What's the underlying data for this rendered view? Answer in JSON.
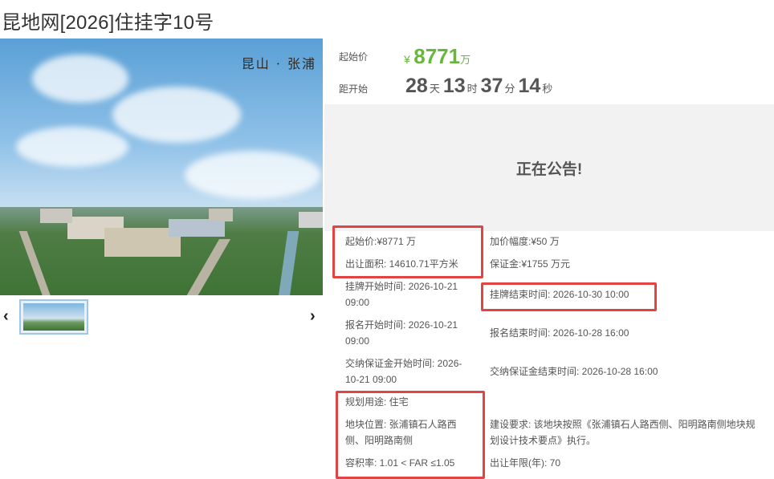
{
  "page_title": "昆地网[2026]住挂字10号",
  "photo": {
    "caption": "昆山 · 张浦"
  },
  "carousel": {
    "prev_label": "‹",
    "next_label": "›"
  },
  "price": {
    "label": "起始价",
    "currency": "¥",
    "value": "8771",
    "unit": "万"
  },
  "countdown": {
    "label": "距开始",
    "days": "28",
    "days_unit": "天",
    "hours": "13",
    "hours_unit": "时",
    "minutes": "37",
    "minutes_unit": "分",
    "seconds": "14",
    "seconds_unit": "秒"
  },
  "notice": "正在公告!",
  "details": {
    "start_price": "起始价:¥8771 万",
    "area": "出让面积: 14610.71平方米",
    "bid_increment": "加价幅度:¥50 万",
    "deposit": "保证金:¥1755 万元",
    "listing_start_1": "挂牌开始时间: 2026-10-21",
    "listing_start_2": "09:00",
    "listing_end": "挂牌结束时间: 2026-10-30 10:00",
    "signup_start_1": "报名开始时间: 2026-10-21",
    "signup_start_2": "09:00",
    "signup_end": "报名结束时间: 2026-10-28 16:00",
    "deposit_start_1": "交纳保证金开始时间: 2026-",
    "deposit_start_2": "10-21 09:00",
    "deposit_end": "交纳保证金结束时间: 2026-10-28 16:00",
    "usage": "规划用途: 住宅",
    "location_1": "地块位置: 张浦镇石人路西",
    "location_2": "侧、阳明路南侧",
    "far": "容积率: 1.01 < FAR ≤1.05",
    "requirement_1": "建设要求: 该地块按照《张浦镇石人路西侧、阳明路南侧地块规",
    "requirement_2": "划设计技术要点》执行。",
    "term": "出让年限(年): 70"
  },
  "colors": {
    "price_green": "#66b83b",
    "highlight_red": "#e24444"
  }
}
